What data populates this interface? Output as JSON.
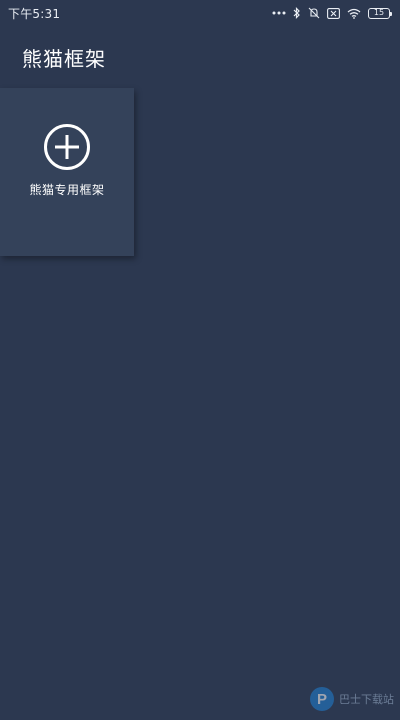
{
  "status_bar": {
    "time": "下午5:31",
    "battery_level": "15",
    "icons": [
      "dots-icon",
      "bluetooth-icon",
      "mute-icon",
      "sim-card-icon",
      "wifi-icon",
      "battery-icon"
    ]
  },
  "header": {
    "title": "熊猫框架"
  },
  "cards": [
    {
      "icon": "add-circle-icon",
      "label": "熊猫专用框架"
    }
  ],
  "watermark": {
    "logo": "p-logo-icon",
    "text": "巴士下载站"
  },
  "colors": {
    "background": "#2c3850",
    "card": "#34425a",
    "text": "#ffffff"
  }
}
